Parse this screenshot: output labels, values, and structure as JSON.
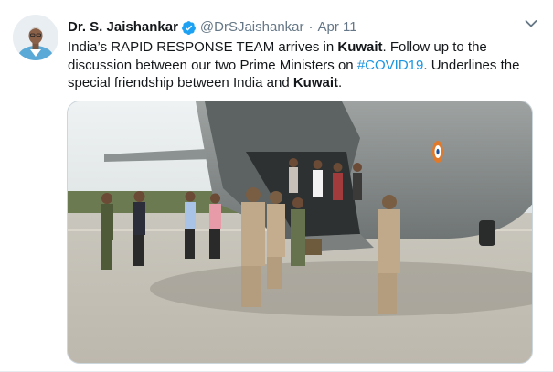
{
  "tweet": {
    "author_name": "Dr. S. Jaishankar",
    "handle": "@DrSJaishankar",
    "separator": "·",
    "date": "Apr 11",
    "text_part1": "India’s RAPID RESPONSE TEAM arrives in ",
    "text_bold1": "Kuwait",
    "text_part2": ". Follow up to the discussion between our two Prime Ministers on ",
    "hashtag": "#COVID19",
    "text_part3": ". Underlines the special friendship between India and ",
    "text_bold2": "Kuwait",
    "text_part4": "."
  },
  "icons": {
    "verified": "verified-badge-icon",
    "caret": "chevron-down-icon"
  },
  "colors": {
    "text": "#14171a",
    "secondary": "#657786",
    "link": "#1b95e0",
    "verified": "#1da1f2"
  }
}
